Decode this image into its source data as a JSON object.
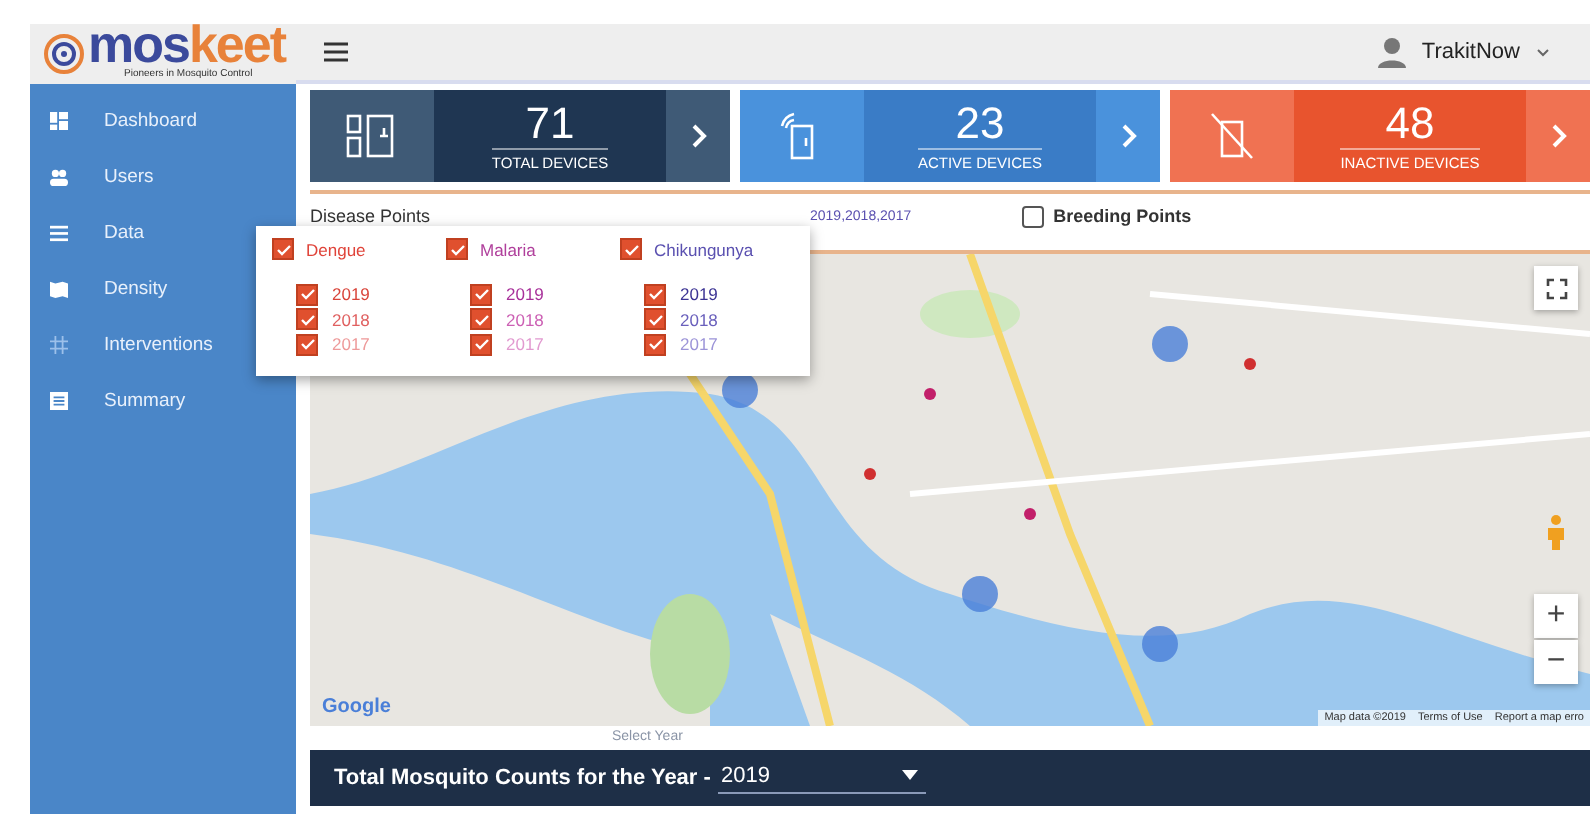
{
  "brand": {
    "name_a": "mos",
    "name_b": "keet",
    "tagline": "Pioneers in Mosquito Control"
  },
  "header": {
    "user": "TrakitNow"
  },
  "sidebar": {
    "items": [
      {
        "label": "Dashboard"
      },
      {
        "label": "Users"
      },
      {
        "label": "Data"
      },
      {
        "label": "Density"
      },
      {
        "label": "Interventions"
      },
      {
        "label": "Summary"
      }
    ]
  },
  "stat_cards": [
    {
      "value": "71",
      "label": "TOTAL DEVICES",
      "kind": "total"
    },
    {
      "value": "23",
      "label": "ACTIVE DEVICES",
      "kind": "active"
    },
    {
      "value": "48",
      "label": "INACTIVE DEVICES",
      "kind": "inactive"
    }
  ],
  "disease_points": {
    "label": "Disease Points",
    "legend_tail": "2019,2018,2017"
  },
  "breeding_points": {
    "label": "Breeding Points",
    "checked": false
  },
  "filter_popup": {
    "groups": [
      {
        "name": "Dengue",
        "checked": true,
        "color": "#e0443a",
        "years": [
          {
            "label": "2019",
            "checked": true,
            "color": "#d9443a"
          },
          {
            "label": "2018",
            "checked": true,
            "color": "#e06060"
          },
          {
            "label": "2017",
            "checked": true,
            "color": "#ee9a9a"
          }
        ]
      },
      {
        "name": "Malaria",
        "checked": true,
        "color": "#b0409c",
        "years": [
          {
            "label": "2019",
            "checked": true,
            "color": "#a8309a"
          },
          {
            "label": "2018",
            "checked": true,
            "color": "#cc60b4"
          },
          {
            "label": "2017",
            "checked": true,
            "color": "#e29ad0"
          }
        ]
      },
      {
        "name": "Chikungunya",
        "checked": true,
        "color": "#5a50b0",
        "years": [
          {
            "label": "2019",
            "checked": true,
            "color": "#3c3494"
          },
          {
            "label": "2018",
            "checked": true,
            "color": "#6a60bc"
          },
          {
            "label": "2017",
            "checked": true,
            "color": "#9c94d8"
          }
        ]
      }
    ]
  },
  "map": {
    "logo": "Google",
    "attribution": [
      "Map data ©2019",
      "Terms of Use",
      "Report a map erro"
    ],
    "zoom_in": "+",
    "zoom_out": "−"
  },
  "year_bar": {
    "title": "Total Mosquito Counts for the Year - ",
    "select_label": "Select Year",
    "value": "2019"
  }
}
